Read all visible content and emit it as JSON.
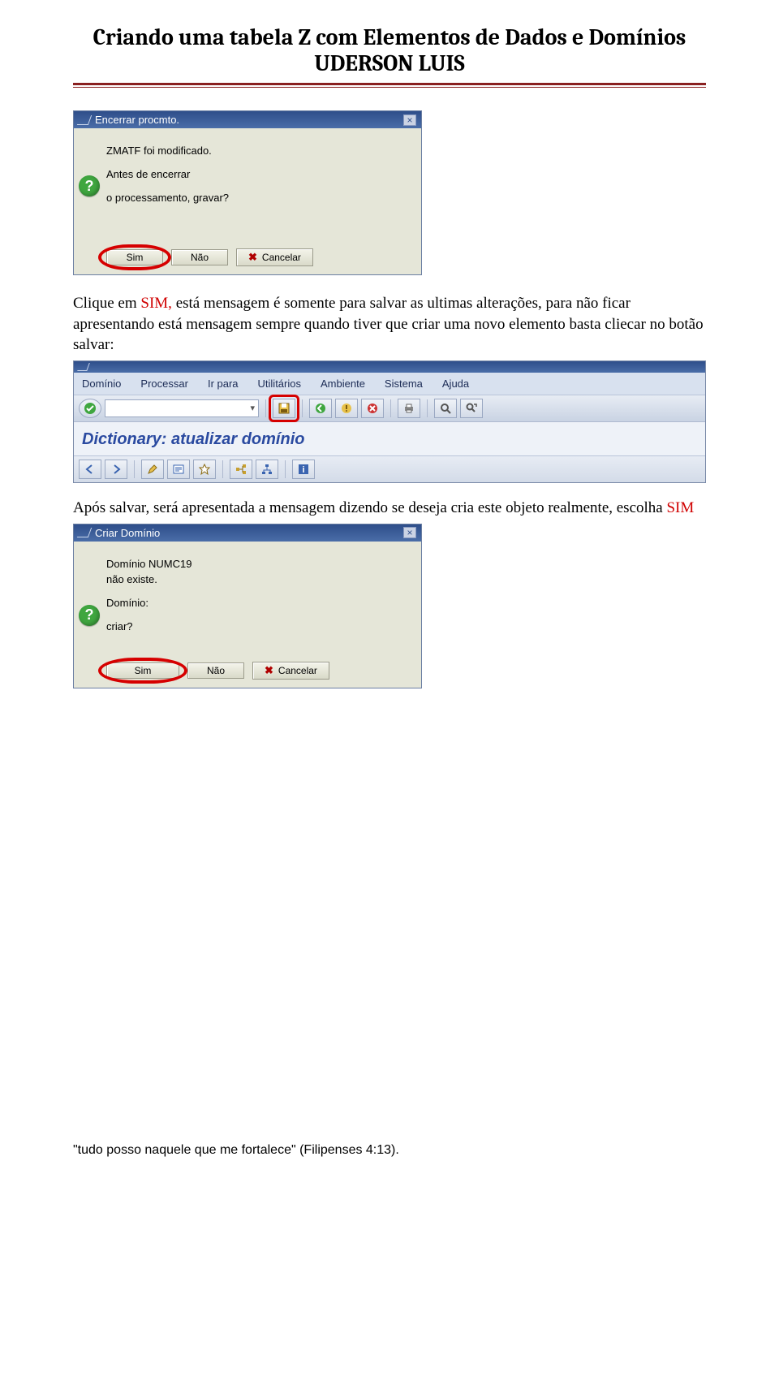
{
  "header": {
    "title": "Criando uma tabela Z com Elementos de Dados e Domínios",
    "author": "UDERSON LUIS"
  },
  "dialog1": {
    "title": "Encerrar procmto.",
    "line1": "ZMATF foi modificado.",
    "line2": "Antes de encerrar",
    "line3": "o processamento, gravar?",
    "btn_sim": "Sim",
    "btn_nao": "Não",
    "btn_cancel": "Cancelar"
  },
  "para1": {
    "pre": "Clique em ",
    "sim": "SIM,",
    "rest": " está mensagem é somente para salvar as ultimas alterações, para não ficar apresentando está mensagem sempre quando tiver que criar uma novo elemento basta cliecar no botão salvar:"
  },
  "sapapp": {
    "menu": [
      "Domínio",
      "Processar",
      "Ir para",
      "Utilitários",
      "Ambiente",
      "Sistema",
      "Ajuda"
    ],
    "heading": "Dictionary: atualizar domínio"
  },
  "para2": {
    "text": "Após salvar, será apresentada a mensagem dizendo se deseja cria este objeto realmente, escolha ",
    "sim": "SIM"
  },
  "dialog2": {
    "title": "Criar Domínio",
    "line1": "Domínio NUMC19",
    "line2": "não existe.",
    "line3": "Domínio:",
    "line4": "criar?",
    "btn_sim": "Sim",
    "btn_nao": "Não",
    "btn_cancel": "Cancelar"
  },
  "footer": {
    "text": "\"tudo posso naquele que me fortalece\" (Filipenses 4:13)."
  }
}
